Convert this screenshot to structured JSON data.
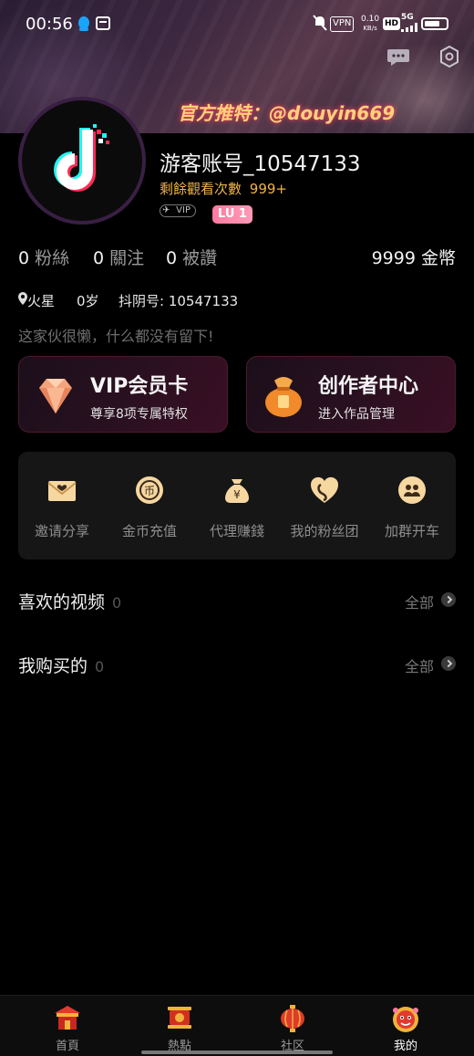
{
  "status": {
    "time": "00:56",
    "vpn": "VPN",
    "speed_value": "0.10",
    "speed_unit": "KB/s",
    "hd": "HD",
    "network": "5G"
  },
  "header": {
    "promo": "官方推特：@douyin669"
  },
  "profile": {
    "username": "游客账号_10547133",
    "views_label": "剩餘觀看次數",
    "views_value": "999+",
    "vip_badge": "VIP",
    "level_badge": "LU 1"
  },
  "stats": {
    "fans_count": "0",
    "fans_label": "粉絲",
    "follow_count": "0",
    "follow_label": "關注",
    "likes_count": "0",
    "likes_label": "被讚",
    "coins": "9999 金幣"
  },
  "info": {
    "location": "火星",
    "age": "0岁",
    "account_id": "抖阴号: 10547133",
    "bio": "这家伙很懒，什么都没有留下!"
  },
  "cards": [
    {
      "title": "VIP会员卡",
      "subtitle": "尊享8项专属特权",
      "icon": "diamond-icon"
    },
    {
      "title": "创作者中心",
      "subtitle": "进入作品管理",
      "icon": "money-bag-icon"
    }
  ],
  "grid": [
    {
      "label": "邀请分享",
      "icon": "envelope-icon"
    },
    {
      "label": "金币充值",
      "icon": "coin-icon"
    },
    {
      "label": "代理赚錢",
      "icon": "money-bag-icon"
    },
    {
      "label": "我的粉丝团",
      "icon": "fan-club-icon"
    },
    {
      "label": "加群开车",
      "icon": "group-chat-icon"
    }
  ],
  "sections": [
    {
      "title": "喜欢的视频",
      "count": "0",
      "all": "全部"
    },
    {
      "title": "我购买的",
      "count": "0",
      "all": "全部"
    }
  ],
  "tabs": [
    {
      "label": "首頁",
      "icon": "home-icon"
    },
    {
      "label": "熱點",
      "icon": "hot-icon"
    },
    {
      "label": "社区",
      "icon": "lantern-icon"
    },
    {
      "label": "我的",
      "icon": "lion-icon"
    }
  ],
  "colors": {
    "accent_gold": "#f0b24b",
    "level_pink": "#ff7aa0",
    "background": "#000000"
  }
}
